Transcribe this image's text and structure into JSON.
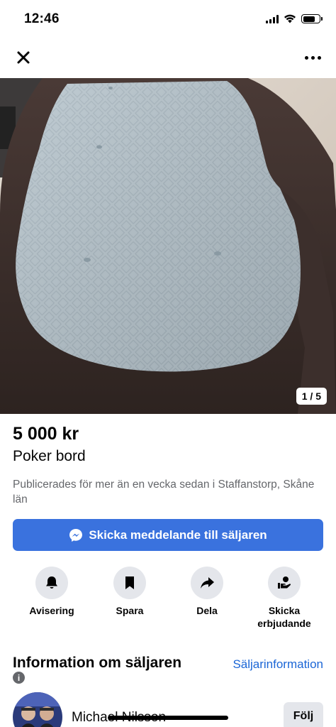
{
  "status_bar": {
    "time": "12:46",
    "battery_level": 0.75
  },
  "nav": {
    "close_icon": "close-icon",
    "more_icon": "more-horizontal-icon"
  },
  "photo": {
    "counter": "1 / 5"
  },
  "listing": {
    "price": "5 000 kr",
    "title": "Poker bord",
    "meta": "Publicerades för mer än en vecka sedan i Staffanstorp, Skåne län"
  },
  "message_button": {
    "label": "Skicka meddelande till säljaren",
    "icon": "messenger-icon",
    "color": "#3a72de"
  },
  "actions": [
    {
      "label": "Avisering",
      "icon": "bell-icon"
    },
    {
      "label": "Spara",
      "icon": "bookmark-icon"
    },
    {
      "label": "Dela",
      "icon": "share-icon"
    },
    {
      "label": "Skicka erbjudande",
      "icon": "offer-icon"
    }
  ],
  "seller": {
    "heading": "Information om säljaren",
    "link": "Säljarinformation",
    "info_icon": "i",
    "name": "Michael Nilsson",
    "follow_label": "Följ",
    "link_color": "#1b66d6"
  }
}
